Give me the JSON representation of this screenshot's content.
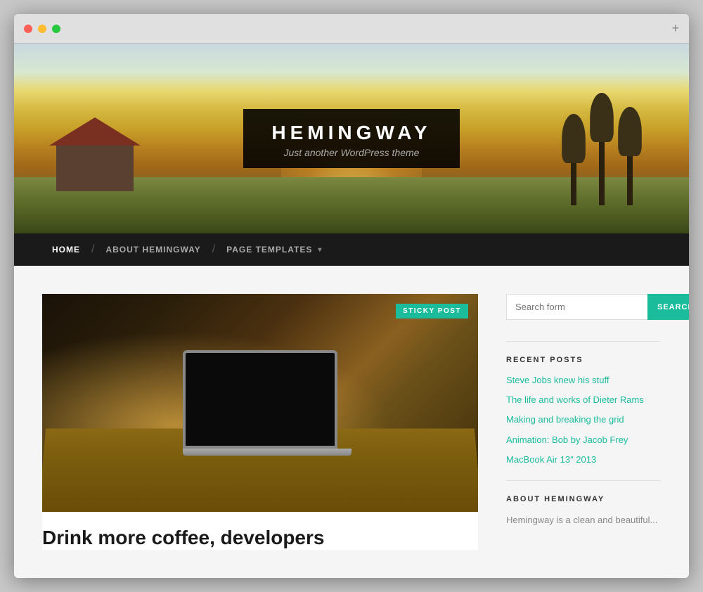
{
  "browser": {
    "dots": [
      "red",
      "yellow",
      "green"
    ],
    "plus_label": "+"
  },
  "hero": {
    "title": "HEMINGWAY",
    "subtitle": "Just another WordPress theme"
  },
  "nav": {
    "items": [
      {
        "label": "HOME",
        "active": true
      },
      {
        "label": "ABOUT HEMINGWAY",
        "active": false
      },
      {
        "label": "PAGE TEMPLATES",
        "active": false,
        "has_chevron": true
      }
    ]
  },
  "main": {
    "post": {
      "sticky_label": "STICKY POST",
      "title": "Drink more coffee, developers"
    },
    "sidebar": {
      "search_placeholder": "Search form",
      "search_button": "SEARCH",
      "recent_posts_heading": "RECENT POSTS",
      "recent_posts": [
        {
          "label": "Steve Jobs knew his stuff"
        },
        {
          "label": "The life and works of Dieter Rams"
        },
        {
          "label": "Making and breaking the grid"
        },
        {
          "label": "Animation: Bob by Jacob Frey"
        },
        {
          "label": "MacBook Air 13″ 2013"
        }
      ],
      "about_heading": "ABOUT HEMINGWAY",
      "about_text": "Hemingway is a clean and beautiful..."
    }
  }
}
